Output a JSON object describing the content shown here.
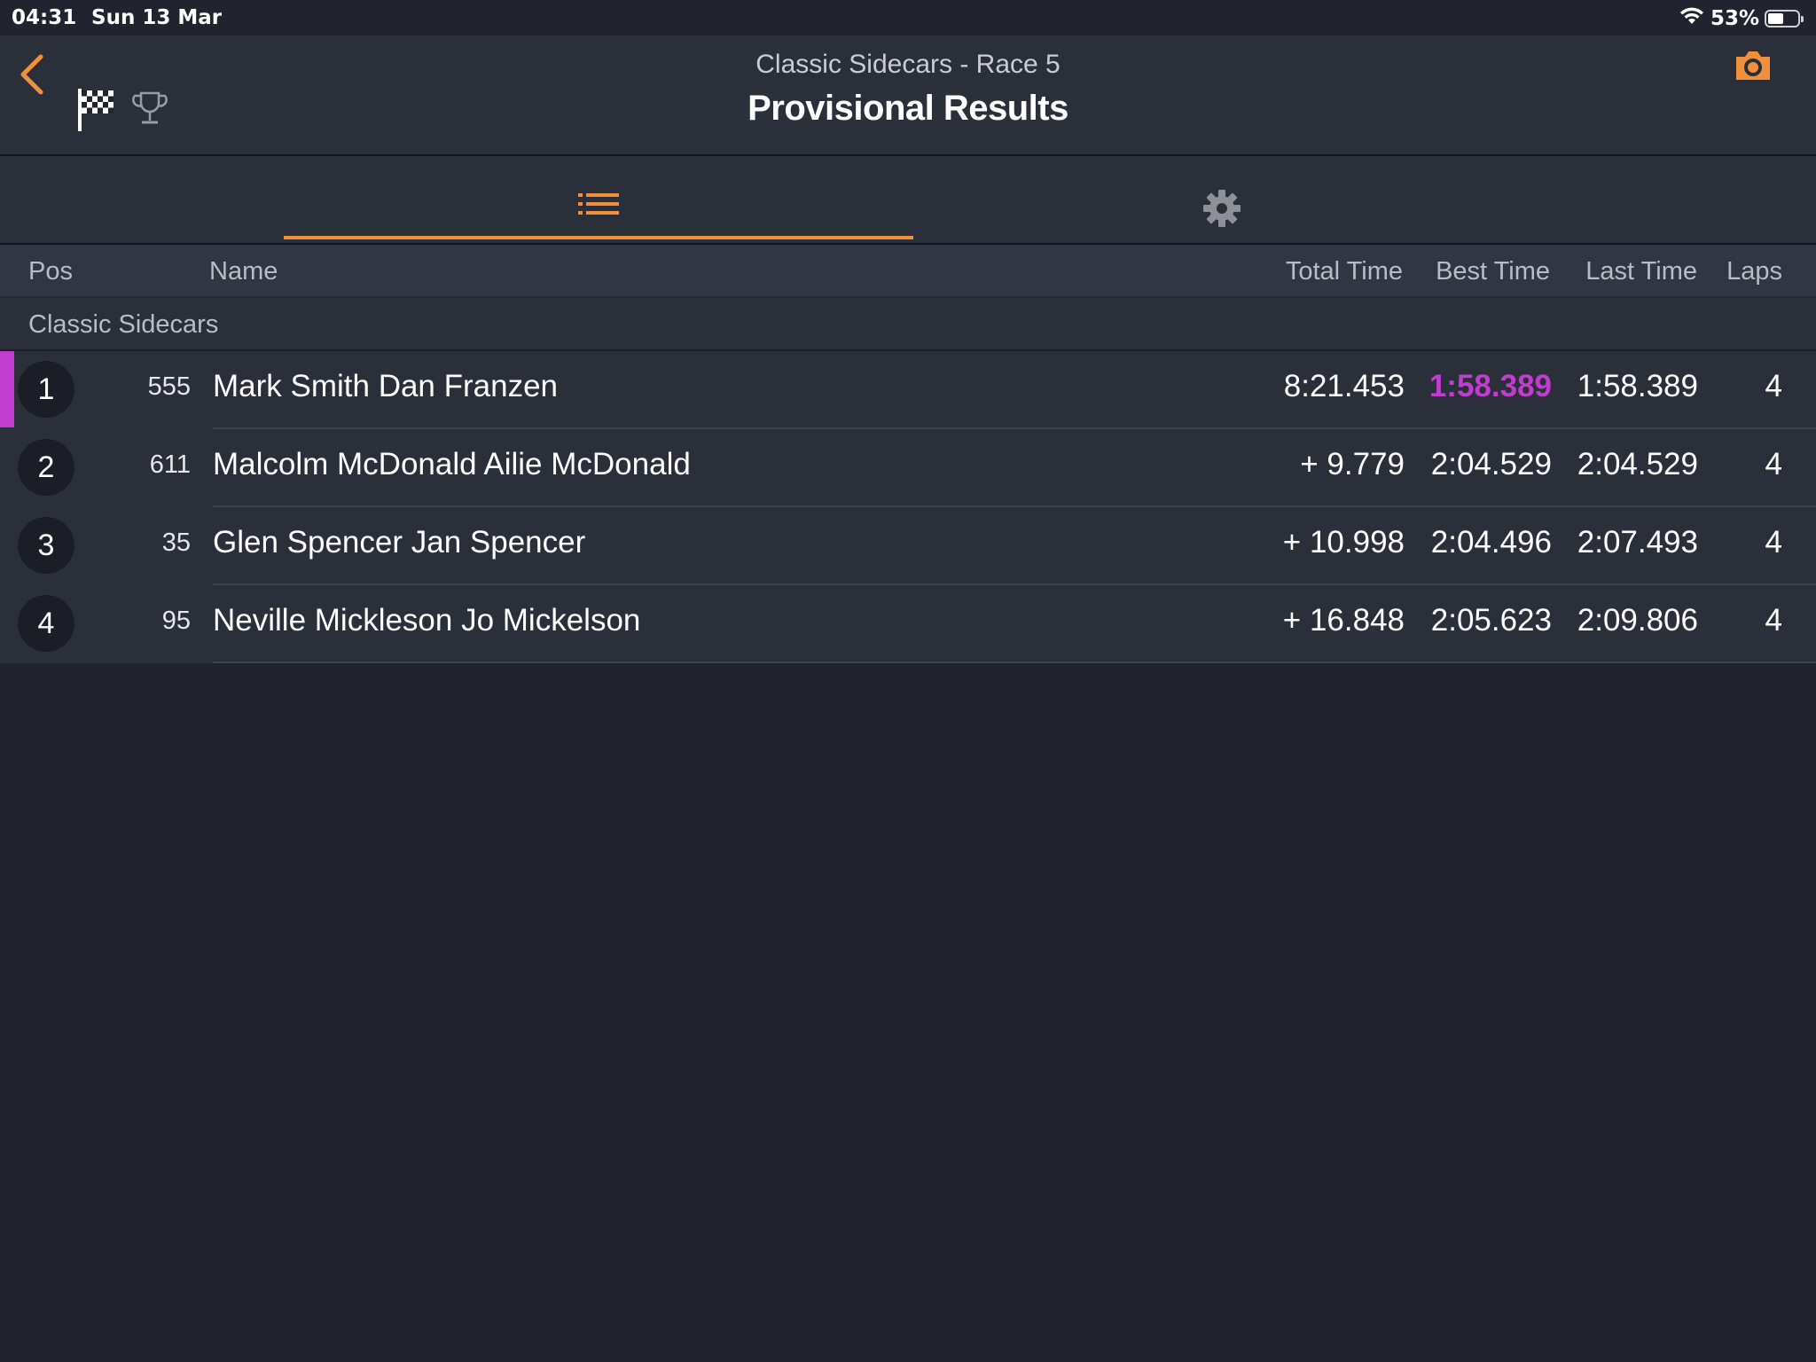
{
  "status_bar": {
    "time": "04:31",
    "date": "Sun 13 Mar",
    "battery": "53%",
    "battery_level": 0.53
  },
  "header": {
    "subtitle": "Classic Sidecars - Race 5",
    "title": "Provisional Results",
    "icons": [
      "back-chevron-icon",
      "checkered-flag-icon",
      "trophy-icon",
      "camera-icon"
    ]
  },
  "tabs": [
    {
      "icon": "list-icon",
      "active": true
    },
    {
      "icon": "gear-icon",
      "active": false
    }
  ],
  "table": {
    "columns": {
      "pos": "Pos",
      "name": "Name",
      "total": "Total Time",
      "best": "Best Time",
      "last": "Last Time",
      "laps": "Laps"
    },
    "section": "Classic Sidecars",
    "rows": [
      {
        "pos": "1",
        "number": "555",
        "name": "Mark Smith Dan Franzen",
        "total": "8:21.453",
        "best": "1:58.389",
        "last": "1:58.389",
        "laps": "4"
      },
      {
        "pos": "2",
        "number": "611",
        "name": "Malcolm McDonald Ailie McDonald",
        "total": "+ 9.779",
        "best": "2:04.529",
        "last": "2:04.529",
        "laps": "4"
      },
      {
        "pos": "3",
        "number": "35",
        "name": "Glen Spencer Jan Spencer",
        "total": "+ 10.998",
        "best": "2:04.496",
        "last": "2:07.493",
        "laps": "4"
      },
      {
        "pos": "4",
        "number": "95",
        "name": "Neville Mickleson Jo Mickelson",
        "total": "+ 16.848",
        "best": "2:05.623",
        "last": "2:09.806",
        "laps": "4"
      }
    ]
  },
  "colors": {
    "accent": "#f0903a",
    "fastest_lap": "#c13ccf",
    "background": "#21242e",
    "panel": "#2b2f3a"
  }
}
